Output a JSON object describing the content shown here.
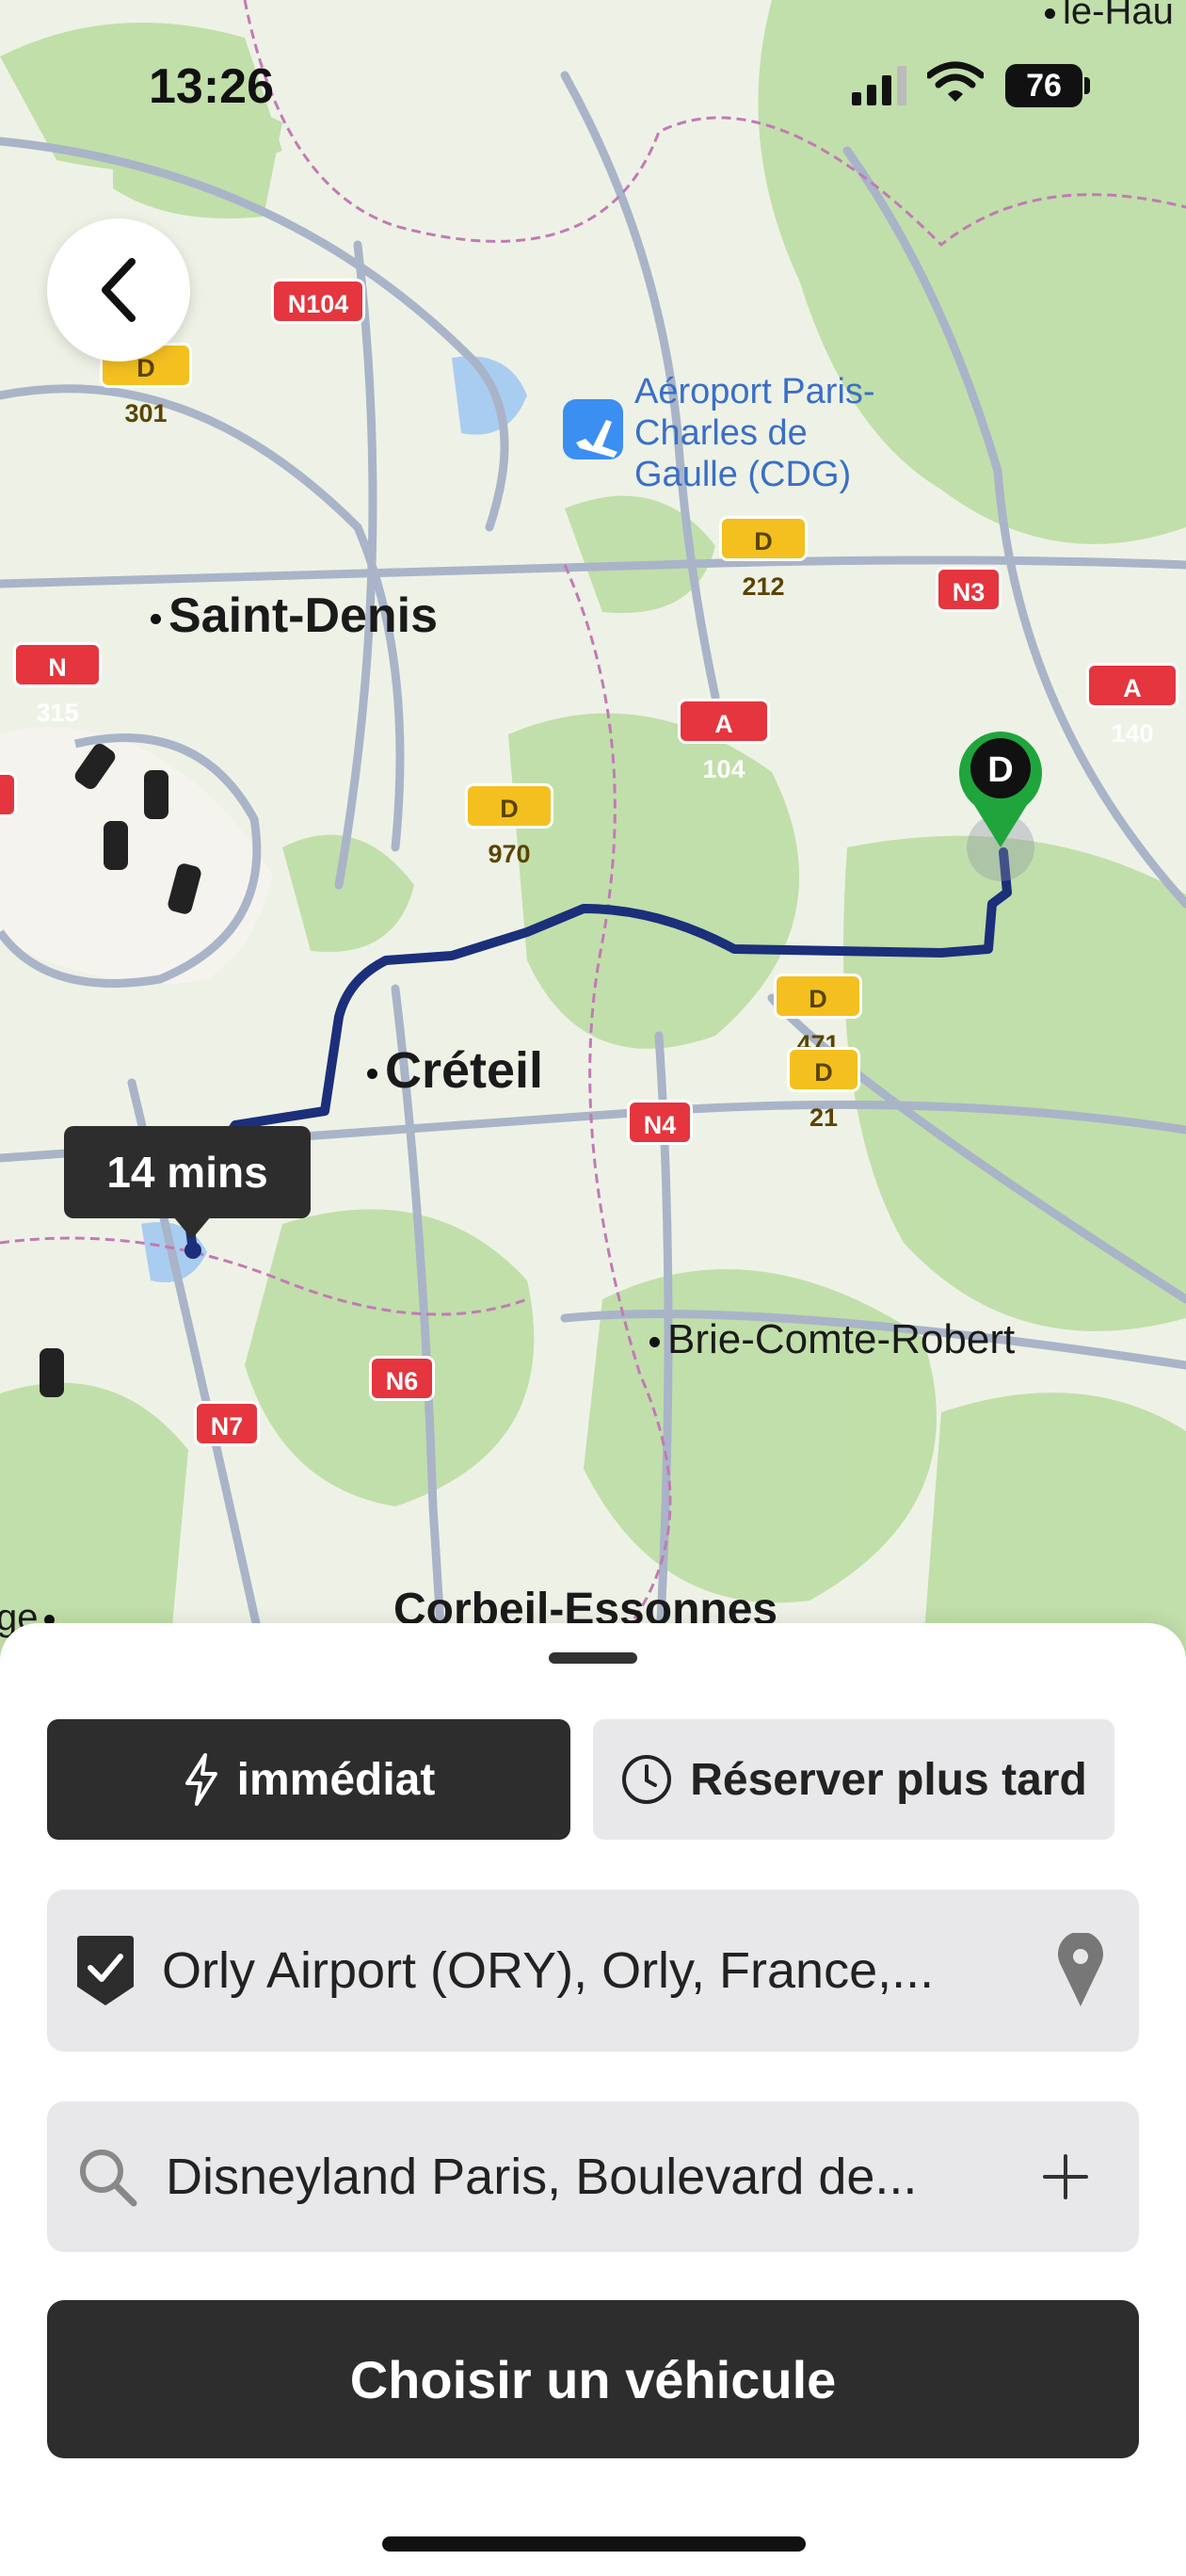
{
  "status_bar": {
    "time": "13:26",
    "battery": "76"
  },
  "map": {
    "road_labels": [
      {
        "id": "n104",
        "text": "N104",
        "color": "red"
      },
      {
        "id": "d301",
        "text": "D 301",
        "color": "yellow"
      },
      {
        "id": "d212",
        "text": "D 212",
        "color": "yellow"
      },
      {
        "id": "n3",
        "text": "N3",
        "color": "red"
      },
      {
        "id": "a140",
        "text": "A 140",
        "color": "red"
      },
      {
        "id": "n315",
        "text": "N 315",
        "color": "red"
      },
      {
        "id": "a104",
        "text": "A 104",
        "color": "red"
      },
      {
        "id": "d970",
        "text": "D 970",
        "color": "yellow"
      },
      {
        "id": "d471",
        "text": "D 471",
        "color": "yellow"
      },
      {
        "id": "d21",
        "text": "D 21",
        "color": "yellow"
      },
      {
        "id": "n4",
        "text": "N4",
        "color": "red"
      },
      {
        "id": "n6",
        "text": "N6",
        "color": "red"
      },
      {
        "id": "n7",
        "text": "N7",
        "color": "red"
      }
    ],
    "places": {
      "saint_denis": "Saint-Denis",
      "creteil": "Créteil",
      "brie": "Brie-Comte-Robert",
      "corbeil": "Corbeil-Essonnes",
      "top_right": "le-Hau",
      "left_edge": "ge"
    },
    "poi": {
      "line1": "Aéroport Paris-",
      "line2": "Charles de",
      "line3": "Gaulle (CDG)"
    },
    "eta_label": "14 mins",
    "destination_marker": "D",
    "route_color": "#1b2f7a"
  },
  "sheet": {
    "tab_now": "immédiat",
    "tab_later": "Réserver plus tard",
    "pickup": "Orly Airport (ORY), Orly, France,...",
    "destination": "Disneyland Paris, Boulevard de...",
    "cta": "Choisir un véhicule"
  }
}
